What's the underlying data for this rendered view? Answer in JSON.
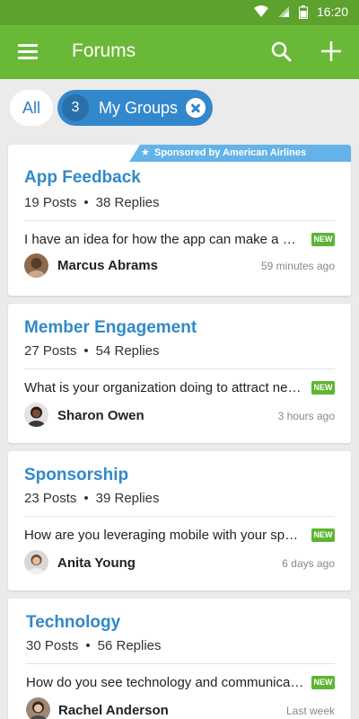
{
  "status_bar": {
    "time": "16:20",
    "icons": [
      "wifi-icon",
      "signal-icon",
      "battery-icon"
    ]
  },
  "app_bar": {
    "title": "Forums",
    "icons": [
      "menu-icon",
      "search-icon",
      "add-icon"
    ]
  },
  "filters": {
    "all_label": "All",
    "group_count": "3",
    "group_label": "My Groups"
  },
  "colors": {
    "app_bar": "#6ab838",
    "status_bar": "#5da12e",
    "accent_blue": "#3189c7",
    "new_badge": "#5cb533",
    "sponsor": "#63b3e8"
  },
  "forums": [
    {
      "title": "App Feedback",
      "posts": "19 Posts",
      "replies": "38 Replies",
      "snippet": "I have an idea for how the app can make a better experience",
      "badge": "NEW",
      "author": "Marcus Abrams",
      "time": "59 minutes ago",
      "sponsor": "Sponsored by American Airlines Company"
    },
    {
      "title": "Member Engagement",
      "posts": "27 Posts",
      "replies": "54 Replies",
      "snippet": "What is your organization doing to attract new members?",
      "badge": "NEW",
      "author": "Sharon Owen",
      "time": "3 hours ago"
    },
    {
      "title": "Sponsorship",
      "posts": "23 Posts",
      "replies": "39 Replies",
      "snippet": "How are you leveraging mobile with your sponsors?",
      "badge": "NEW",
      "author": "Anita Young",
      "time": "6 days ago"
    },
    {
      "title": "Technology",
      "posts": "30 Posts",
      "replies": "56 Replies",
      "snippet": "How do you see technology and communication evolving?",
      "badge": "NEW",
      "author": "Rachel Anderson",
      "time": "Last week"
    }
  ]
}
